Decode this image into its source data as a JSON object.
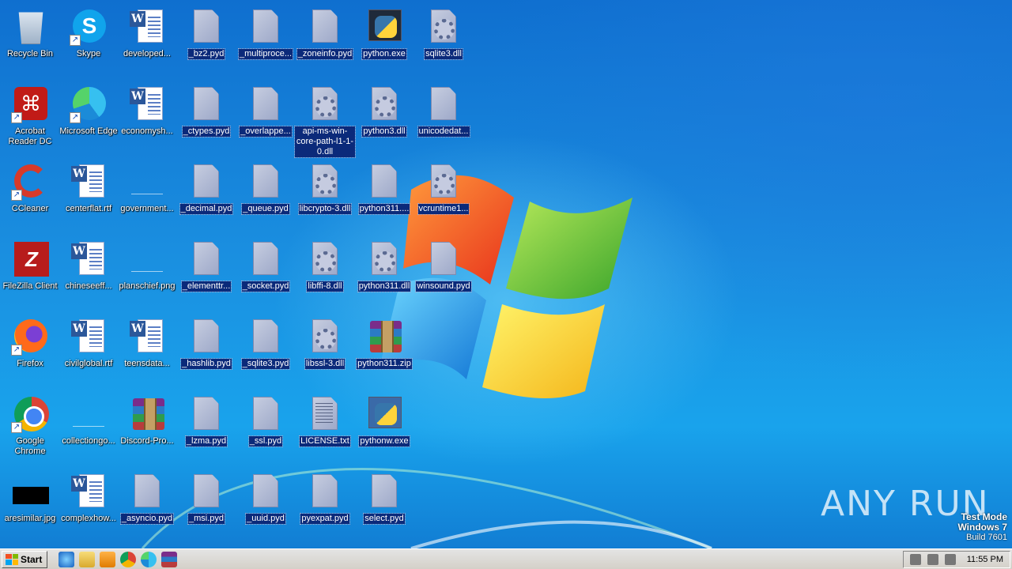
{
  "desktop": {
    "icons": [
      {
        "label": "Recycle Bin",
        "kind": "recycle-bin-icon"
      },
      {
        "label": "Skype",
        "kind": "skype-icon"
      },
      {
        "label": "developed...",
        "kind": "word-document-icon"
      },
      {
        "label": "_bz2.pyd",
        "kind": "file-icon"
      },
      {
        "label": "_multiproce...",
        "kind": "file-icon"
      },
      {
        "label": "_zoneinfo.pyd",
        "kind": "file-icon"
      },
      {
        "label": "python.exe",
        "kind": "python-icon"
      },
      {
        "label": "sqlite3.dll",
        "kind": "dll-icon"
      },
      {
        "label": "Acrobat Reader DC",
        "kind": "acrobat-icon"
      },
      {
        "label": "Microsoft Edge",
        "kind": "edge-icon"
      },
      {
        "label": "economysh...",
        "kind": "word-document-icon"
      },
      {
        "label": "_ctypes.pyd",
        "kind": "file-icon"
      },
      {
        "label": "_overlappe...",
        "kind": "file-icon"
      },
      {
        "label": "api-ms-win-core-path-l1-1-0.dll",
        "kind": "dll-icon"
      },
      {
        "label": "python3.dll",
        "kind": "dll-icon"
      },
      {
        "label": "unicodedat...",
        "kind": "file-icon"
      },
      {
        "label": "CCleaner",
        "kind": "ccleaner-icon"
      },
      {
        "label": "centerflat.rtf",
        "kind": "word-document-icon"
      },
      {
        "label": "government...",
        "kind": "image-icon"
      },
      {
        "label": "_decimal.pyd",
        "kind": "file-icon"
      },
      {
        "label": "_queue.pyd",
        "kind": "file-icon"
      },
      {
        "label": "libcrypto-3.dll",
        "kind": "dll-icon"
      },
      {
        "label": "python311....",
        "kind": "file-icon"
      },
      {
        "label": "vcruntime1...",
        "kind": "dll-icon"
      },
      {
        "label": "FileZilla Client",
        "kind": "filezilla-icon"
      },
      {
        "label": "chineseeff...",
        "kind": "word-document-icon"
      },
      {
        "label": "planschief.png",
        "kind": "image-icon"
      },
      {
        "label": "_elementtr...",
        "kind": "file-icon"
      },
      {
        "label": "_socket.pyd",
        "kind": "file-icon"
      },
      {
        "label": "libffi-8.dll",
        "kind": "dll-icon"
      },
      {
        "label": "python311.dll",
        "kind": "dll-icon"
      },
      {
        "label": "winsound.pyd",
        "kind": "file-icon"
      },
      {
        "label": "Firefox",
        "kind": "firefox-icon"
      },
      {
        "label": "civilglobal.rtf",
        "kind": "word-document-icon"
      },
      {
        "label": "teensdata...",
        "kind": "word-document-icon"
      },
      {
        "label": "_hashlib.pyd",
        "kind": "file-icon"
      },
      {
        "label": "_sqlite3.pyd",
        "kind": "file-icon"
      },
      {
        "label": "libssl-3.dll",
        "kind": "dll-icon"
      },
      {
        "label": "python311.zip",
        "kind": "winrar-icon"
      },
      {
        "label": "Google Chrome",
        "kind": "chrome-icon"
      },
      {
        "label": "collectiongo...",
        "kind": "image-icon"
      },
      {
        "label": "Discord-Pro...",
        "kind": "winrar-icon"
      },
      {
        "label": "_lzma.pyd",
        "kind": "file-icon"
      },
      {
        "label": "_ssl.pyd",
        "kind": "file-icon"
      },
      {
        "label": "LICENSE.txt",
        "kind": "text-file-icon"
      },
      {
        "label": "pythonw.exe",
        "kind": "python-icon"
      },
      {
        "label": "aresimilar.jpg",
        "kind": "jpg-thumbnail-icon"
      },
      {
        "label": "complexhow...",
        "kind": "word-document-icon"
      },
      {
        "label": "_asyncio.pyd",
        "kind": "file-icon"
      },
      {
        "label": "_msi.pyd",
        "kind": "file-icon"
      },
      {
        "label": "_uuid.pyd",
        "kind": "file-icon"
      },
      {
        "label": "pyexpat.pyd",
        "kind": "file-icon"
      },
      {
        "label": "select.pyd",
        "kind": "file-icon"
      }
    ]
  },
  "watermark": {
    "text": "ANY RUN"
  },
  "test_mode": {
    "line1": "Test Mode",
    "line2": "Windows 7",
    "line3": "Build 7601"
  },
  "taskbar": {
    "start_label": "Start",
    "quick_launch": [
      "internet-explorer-icon",
      "file-explorer-icon",
      "media-player-icon",
      "chrome-icon",
      "edge-icon",
      "winrar-icon"
    ],
    "clock": "11:55 PM"
  }
}
